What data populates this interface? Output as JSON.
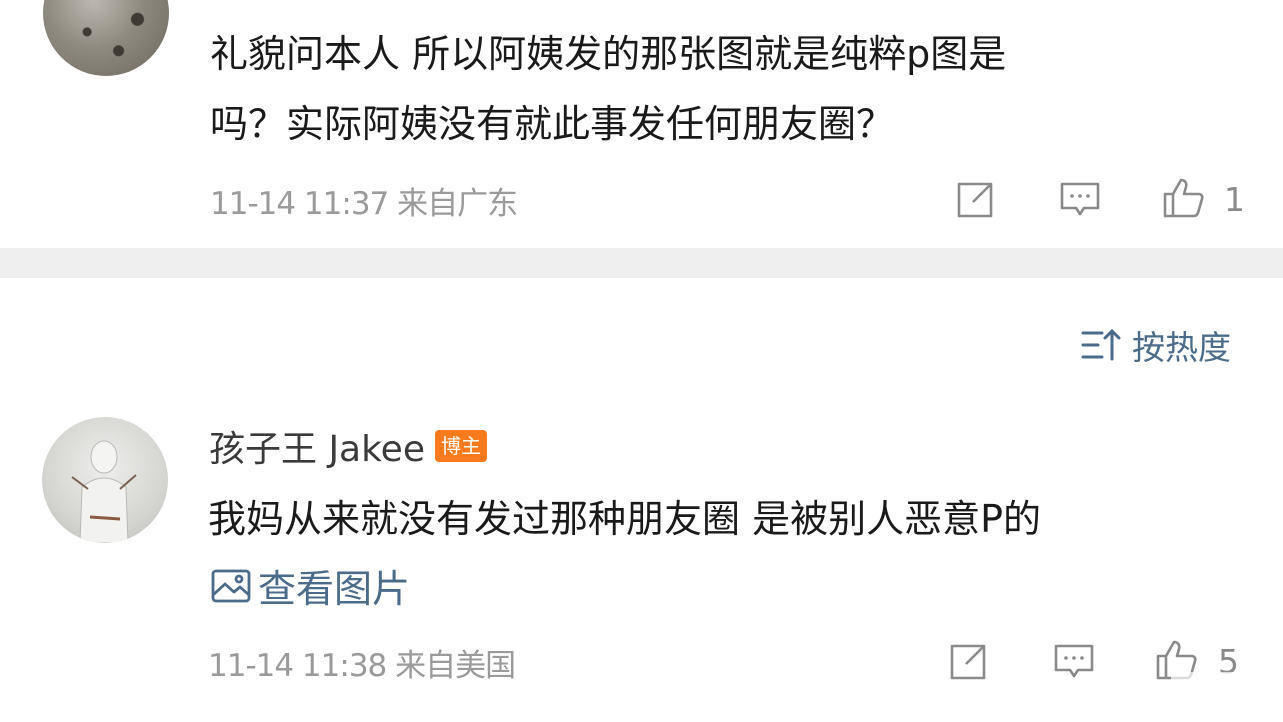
{
  "comment1": {
    "text_line1": "礼貌问本人 所以阿姨发的那张图就是纯粹p图是",
    "text_line2": "吗？实际阿姨没有就此事发任何朋友圈？",
    "timestamp": "11-14 11:37",
    "location": "来自广东",
    "like_count": "1",
    "icons": [
      "repost-icon",
      "comment-icon",
      "like-icon"
    ]
  },
  "sort": {
    "label": "按热度",
    "icon": "sort-icon"
  },
  "comment2": {
    "username": "孩子王 Jakee",
    "badge": "博主",
    "text": "我妈从来就没有发过那种朋友圈 是被别人恶意P的",
    "view_image_label": "查看图片",
    "timestamp": "11-14 11:38",
    "location": "来自美国",
    "like_count": "5",
    "icons": [
      "image-icon",
      "repost-icon",
      "comment-icon",
      "like-icon"
    ]
  },
  "colors": {
    "link": "#4a6b8a",
    "meta": "#9a9a9a",
    "badge": "#f77b1c",
    "divider": "#efefef"
  }
}
